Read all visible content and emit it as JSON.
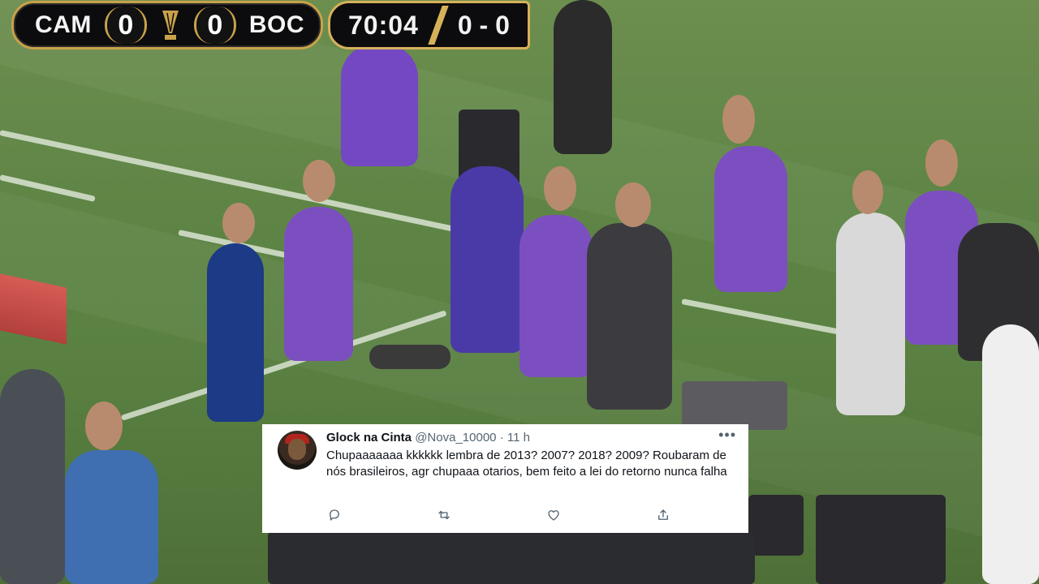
{
  "scoreboard": {
    "home_team": "CAM",
    "home_score": "0",
    "away_score": "0",
    "away_team": "BOC",
    "clock": "70:04",
    "aggregate": "0 - 0"
  },
  "tweet": {
    "author_name": "Glock na Cinta",
    "handle": "@Nova_10000",
    "separator": "·",
    "time": "11 h",
    "more": "•••",
    "text": "Chupaaaaaaa kkkkkk lembra de 2013? 2007? 2018? 2009? Roubaram de nós brasileiros, agr chupaaa otarios, bem feito a lei do retorno nunca falha",
    "actions": [
      "reply-icon",
      "retweet-icon",
      "like-icon",
      "share-icon"
    ]
  },
  "colors": {
    "scoreboard_gold": "#c9a24a",
    "scoreboard_bg": "#0c0c0e",
    "pitch_green": "#5f8546",
    "tweet_text": "#0f1419",
    "tweet_meta": "#536471"
  }
}
